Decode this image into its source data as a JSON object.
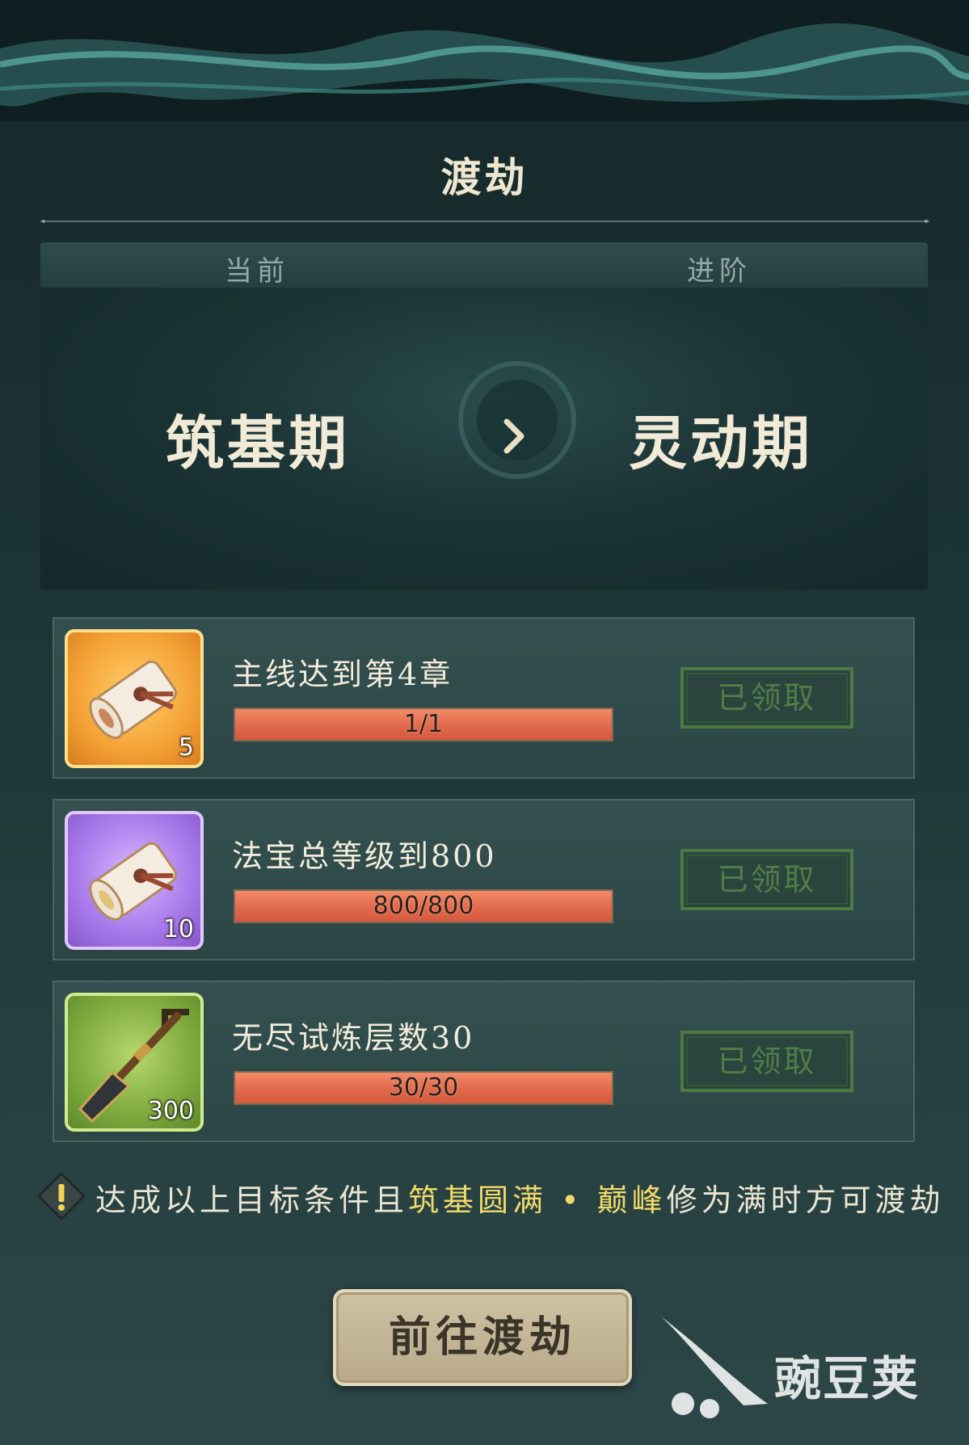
{
  "title": "渡劫",
  "stage": {
    "current_label": "当前",
    "next_label": "进阶",
    "current_name": "筑基期",
    "next_name": "灵动期"
  },
  "tasks": [
    {
      "title": "主线达到第4章",
      "progress_text": "1/1",
      "progress": 1.0,
      "status": "已领取",
      "reward_qty": "5",
      "reward_icon": "scroll-icon",
      "rarity_color": "#f4a236"
    },
    {
      "title": "法宝总等级到800",
      "progress_text": "800/800",
      "progress": 1.0,
      "status": "已领取",
      "reward_qty": "10",
      "reward_icon": "scroll-icon",
      "rarity_color": "#a879ea"
    },
    {
      "title": "无尽试炼层数30",
      "progress_text": "30/30",
      "progress": 1.0,
      "status": "已领取",
      "reward_qty": "300",
      "reward_icon": "shovel-icon",
      "rarity_color": "#7eaa3e"
    }
  ],
  "notice": {
    "prefix": "达成以上目标条件且",
    "highlight": "筑基圆满 • 巅峰",
    "suffix": "修为满时方可渡劫"
  },
  "go_button": "前往渡劫",
  "watermark": "豌豆荚"
}
